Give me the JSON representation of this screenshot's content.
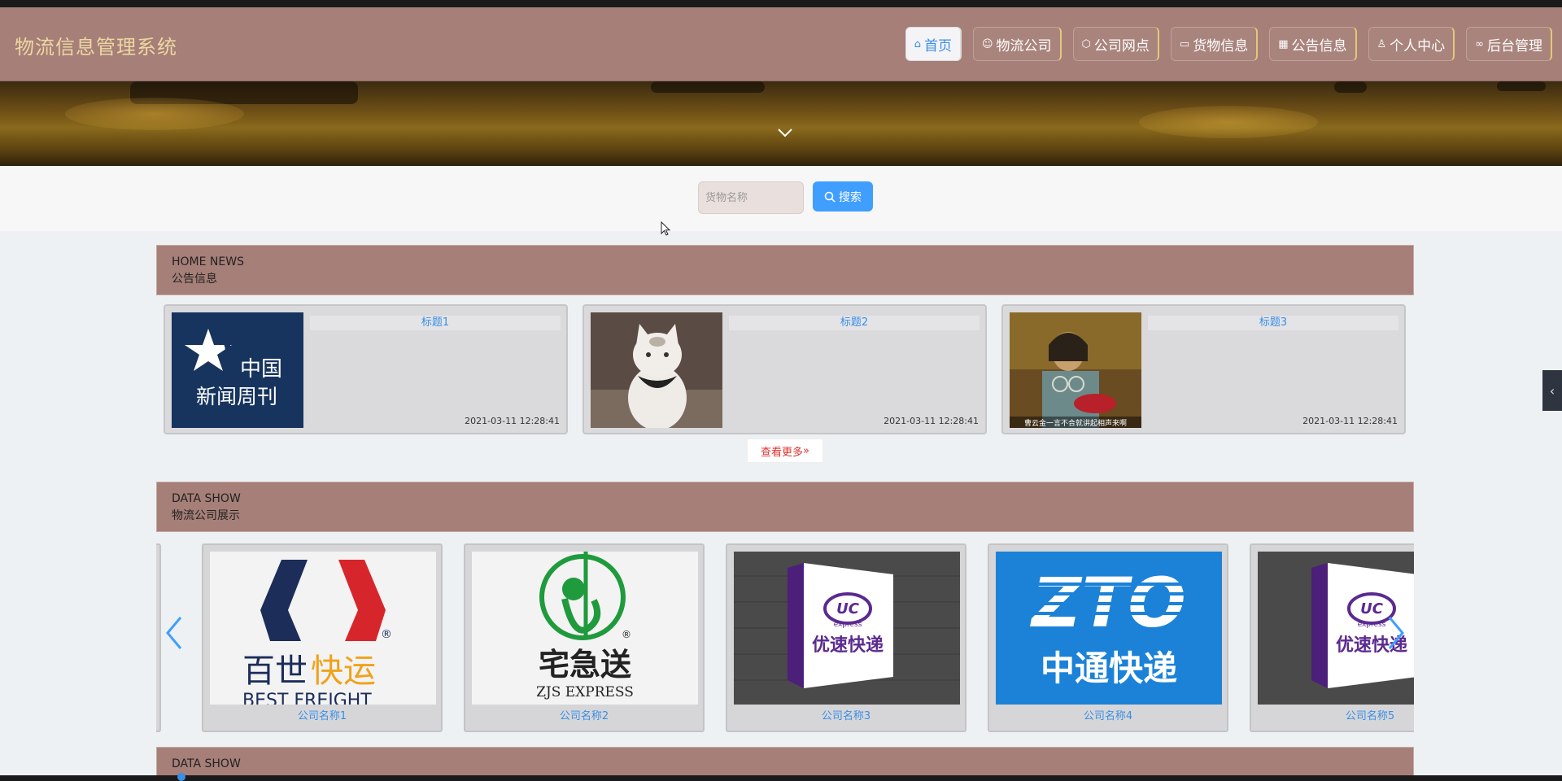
{
  "app": {
    "title": "物流信息管理系统"
  },
  "nav": [
    {
      "label": "首页",
      "icon": "home-icon",
      "active": true
    },
    {
      "label": "物流公司",
      "icon": "smile-icon"
    },
    {
      "label": "公司网点",
      "icon": "box-icon"
    },
    {
      "label": "货物信息",
      "icon": "book-icon"
    },
    {
      "label": "公告信息",
      "icon": "notice-icon"
    },
    {
      "label": "个人中心",
      "icon": "user-icon"
    },
    {
      "label": "后台管理",
      "icon": "link-icon"
    }
  ],
  "search": {
    "placeholder": "货物名称",
    "value": "",
    "button_label": "搜索"
  },
  "news_section": {
    "en": "HOME NEWS",
    "cn": "公告信息"
  },
  "news": [
    {
      "title": "标题1",
      "time": "2021-03-11 12:28:41",
      "image": "news-weekly-logo"
    },
    {
      "title": "标题2",
      "time": "2021-03-11 12:28:41",
      "image": "cat-photo"
    },
    {
      "title": "标题3",
      "time": "2021-03-11 12:28:41",
      "image": "performer-photo"
    }
  ],
  "more_label": "查看更多",
  "companies_section": {
    "en": "DATA SHOW",
    "cn": "物流公司展示"
  },
  "companies": [
    {
      "name": "公司名称1",
      "logo": "best-freight-logo"
    },
    {
      "name": "公司名称2",
      "logo": "zjs-express-logo"
    },
    {
      "name": "公司名称3",
      "logo": "uc-express-sign"
    },
    {
      "name": "公司名称4",
      "logo": "zto-logo"
    },
    {
      "name": "公司名称5",
      "logo": "uc-express-sign"
    }
  ],
  "logos": {
    "news_weekly": [
      "中国",
      "新闻周刊"
    ],
    "news_caption": "曹云金一言不合就讲起相声来啊",
    "best": [
      "百世",
      "快运",
      "BEST FREIGHT"
    ],
    "zjs": [
      "宅急送",
      "ZJS EXPRESS"
    ],
    "uc": [
      "UC",
      "express",
      "优速快递"
    ],
    "zto": [
      "ZTO",
      "中通快递"
    ]
  },
  "third_section": {
    "en": "DATA SHOW"
  },
  "colors": {
    "header": "#a67f78",
    "brand_text": "#ecd8a2",
    "accent": "#409eff",
    "link": "#3a8ee6",
    "more": "#e0302a"
  }
}
